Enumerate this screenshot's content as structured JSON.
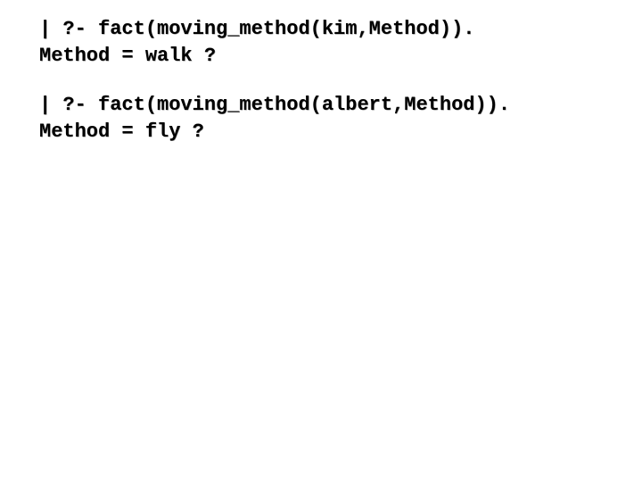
{
  "blocks": [
    {
      "query": "| ?- fact(moving_method(kim,Method)).",
      "result": "Method = walk ?"
    },
    {
      "query": "| ?- fact(moving_method(albert,Method)).",
      "result": "Method = fly ?"
    }
  ]
}
